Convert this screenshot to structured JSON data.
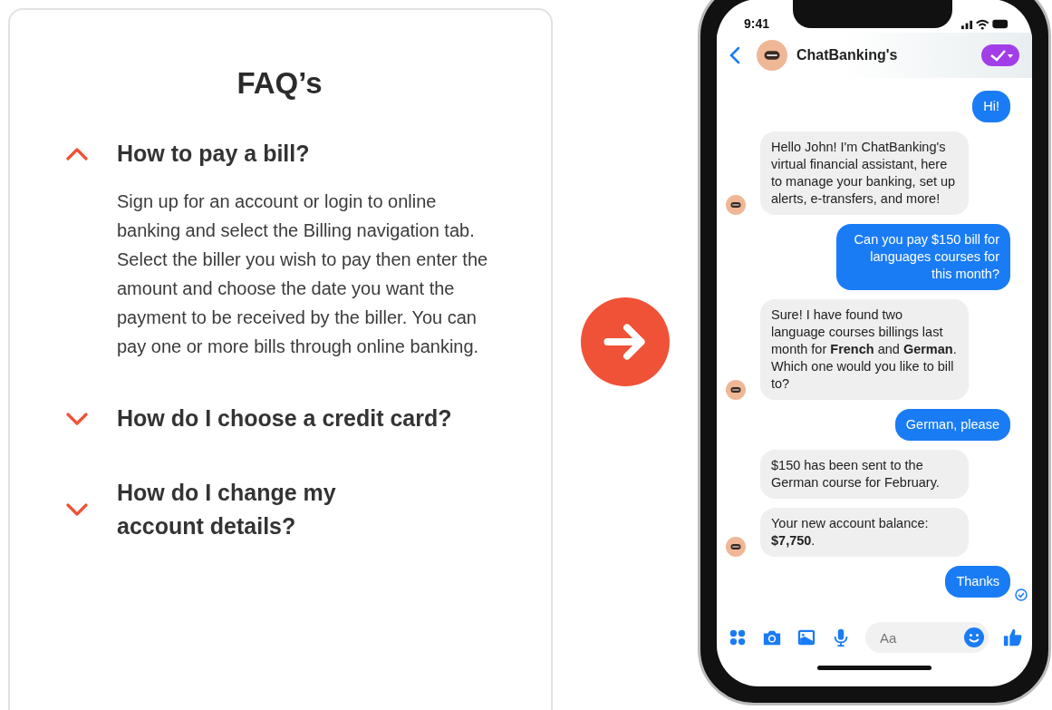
{
  "faq": {
    "title": "FAQ’s",
    "items": [
      {
        "question": "How to pay a bill?",
        "expanded": true,
        "answer": "Sign up for an account or login to online banking and select the Billing navigation tab. Select the biller you wish to pay then enter the amount and choose the date you want the payment to be received by the biller. You can pay one or more bills through online banking."
      },
      {
        "question": "How do I choose a credit card?",
        "expanded": false
      },
      {
        "question": "How do I change my account details?",
        "expanded": false
      }
    ]
  },
  "phone": {
    "time": "9:41",
    "chat": {
      "name": "ChatBanking's",
      "messages": [
        {
          "kind": "user",
          "text": "Hi!"
        },
        {
          "kind": "bot",
          "text": "Hello John! I'm ChatBanking's virtual financial assistant, here to manage your banking, set up alerts, e-transfers, and more!",
          "avatar": true
        },
        {
          "kind": "user",
          "text": "Can you pay $150 bill for languages courses for this month?"
        },
        {
          "kind": "bot",
          "text": "Sure! I have found two language courses billings last month for **French** and **German**. Which one would you like to bill to?",
          "avatar": true
        },
        {
          "kind": "user",
          "text": "German, please"
        },
        {
          "kind": "bot",
          "text": "$150 has been sent to the German course for February.",
          "avatar": false
        },
        {
          "kind": "bot",
          "text": "Your new account balance: **$7,750**.",
          "avatar": true
        },
        {
          "kind": "user",
          "text": "Thanks",
          "seen": true
        }
      ],
      "input": {
        "placeholder": "Aa"
      }
    }
  }
}
